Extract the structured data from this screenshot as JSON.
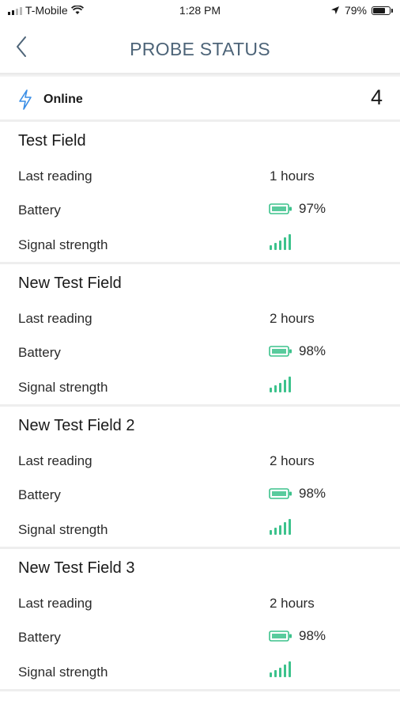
{
  "status_bar": {
    "carrier": "T-Mobile",
    "time": "1:28 PM",
    "battery_percent": "79%",
    "battery_level": 0.79
  },
  "nav": {
    "title": "PROBE STATUS",
    "back_icon": "chevron-left-icon"
  },
  "online": {
    "label": "Online",
    "count": "4",
    "icon": "lightning-icon"
  },
  "fields": [
    {
      "name": "Test Field",
      "last_reading_label": "Last reading",
      "last_reading": "1 hours",
      "battery_label": "Battery",
      "battery": "97%",
      "signal_label": "Signal strength",
      "signal_bars": 5
    },
    {
      "name": "New Test Field",
      "last_reading_label": "Last reading",
      "last_reading": "2 hours",
      "battery_label": "Battery",
      "battery": "98%",
      "signal_label": "Signal strength",
      "signal_bars": 5
    },
    {
      "name": "New Test Field 2",
      "last_reading_label": "Last reading",
      "last_reading": "2 hours",
      "battery_label": "Battery",
      "battery": "98%",
      "signal_label": "Signal strength",
      "signal_bars": 5
    },
    {
      "name": "New Test Field 3",
      "last_reading_label": "Last reading",
      "last_reading": "2 hours",
      "battery_label": "Battery",
      "battery": "98%",
      "signal_label": "Signal strength",
      "signal_bars": 5
    }
  ],
  "colors": {
    "accent_green": "#3cc28c",
    "title_slate": "#4d6478",
    "icon_blue": "#3a8ee6"
  }
}
